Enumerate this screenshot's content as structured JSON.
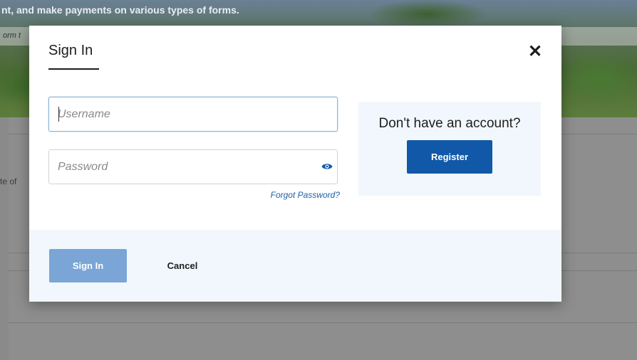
{
  "background": {
    "hero_text": "nt, and make payments on various types of forms.",
    "band_text": "orm t",
    "side_text": "te of"
  },
  "modal": {
    "title": "Sign In",
    "close_icon": "close-icon",
    "username": {
      "placeholder": "Username",
      "value": ""
    },
    "password": {
      "placeholder": "Password",
      "value": "",
      "toggle_icon": "eye-icon"
    },
    "forgot_password": "Forgot Password?",
    "register_panel": {
      "prompt": "Don't have an account?",
      "register_label": "Register"
    },
    "footer": {
      "sign_in_label": "Sign In",
      "cancel_label": "Cancel"
    }
  },
  "colors": {
    "primary": "#1159a8",
    "primary_disabled": "#7aa5d6",
    "link": "#1f5fa3",
    "panel_bg": "#f1f7fd"
  }
}
